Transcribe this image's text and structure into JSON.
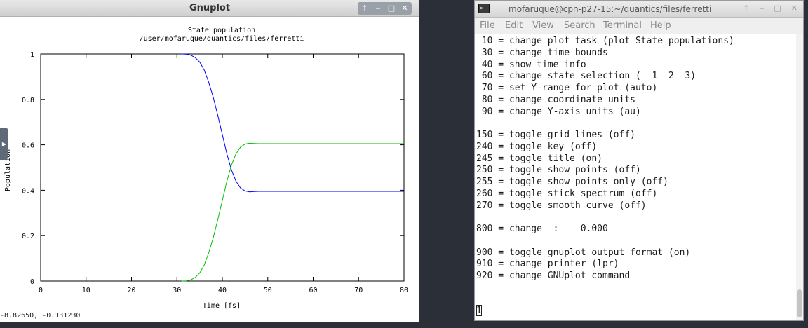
{
  "gnuplot": {
    "window_title": "Gnuplot",
    "title_line1": "State population",
    "title_line2": "/user/mofaruque/quantics/files/ferretti",
    "ylabel": "Population",
    "xlabel": "Time [fs]",
    "coords": "-8.82650, -0.131230",
    "controls": [
      "↑",
      "‒",
      "□",
      "✕"
    ],
    "side_tab_glyph": "▶"
  },
  "chart_data": {
    "type": "line",
    "title": "State population\n/user/mofaruque/quantics/files/ferretti",
    "xlabel": "Time [fs]",
    "ylabel": "Population",
    "xlim": [
      0,
      80
    ],
    "ylim": [
      0,
      1
    ],
    "x_ticks": [
      "0",
      "10",
      "20",
      "30",
      "40",
      "50",
      "60",
      "70",
      "80"
    ],
    "y_ticks": [
      "0",
      "0.2",
      "0.4",
      "0.6",
      "0.8",
      "1"
    ],
    "grid": false,
    "legend": "none",
    "series": [
      {
        "color": "#0000ff",
        "x": [
          31,
          32,
          33,
          34,
          35,
          36,
          37,
          38,
          39,
          40,
          41,
          42,
          43,
          44,
          45,
          46,
          47,
          48,
          50,
          55,
          60,
          70,
          80
        ],
        "values": [
          1.0,
          0.999,
          0.995,
          0.985,
          0.965,
          0.93,
          0.875,
          0.81,
          0.73,
          0.645,
          0.56,
          0.49,
          0.44,
          0.41,
          0.397,
          0.393,
          0.394,
          0.395,
          0.395,
          0.395,
          0.395,
          0.395,
          0.395
        ]
      },
      {
        "color": "#00c000",
        "x": [
          31,
          32,
          33,
          34,
          35,
          36,
          37,
          38,
          39,
          40,
          41,
          42,
          43,
          44,
          45,
          46,
          47,
          48,
          50,
          55,
          60,
          70,
          80
        ],
        "values": [
          0.0,
          0.001,
          0.005,
          0.015,
          0.035,
          0.07,
          0.125,
          0.19,
          0.27,
          0.355,
          0.44,
          0.51,
          0.56,
          0.59,
          0.603,
          0.607,
          0.606,
          0.605,
          0.605,
          0.605,
          0.605,
          0.605,
          0.605
        ]
      }
    ]
  },
  "terminal": {
    "window_title": "mofaruque@cpn-p27-15:~/quantics/files/ferretti",
    "icon_glyph": ">_",
    "controls": [
      "↑",
      "‒",
      "□",
      "✕"
    ],
    "menu": [
      "File",
      "Edit",
      "View",
      "Search",
      "Terminal",
      "Help"
    ],
    "lines": [
      " 10 = change plot task (plot State populations)",
      " 30 = change time bounds",
      " 40 = show time info",
      " 60 = change state selection (  1  2  3)",
      " 70 = set Y-range for plot (auto)",
      " 80 = change coordinate units",
      " 90 = change Y-axis units (au)",
      "",
      "150 = toggle grid lines (off)",
      "240 = toggle key (off)",
      "245 = toggle title (on)",
      "250 = toggle show points (off)",
      "255 = toggle show points only (off)",
      "260 = toggle stick spectrum (off)",
      "270 = toggle smooth curve (off)",
      "",
      "800 = change  :    0.000",
      "",
      "900 = toggle gnuplot output format (on)",
      "910 = change printer (lpr)",
      "920 = change GNUplot command",
      "",
      "",
      "1"
    ]
  }
}
